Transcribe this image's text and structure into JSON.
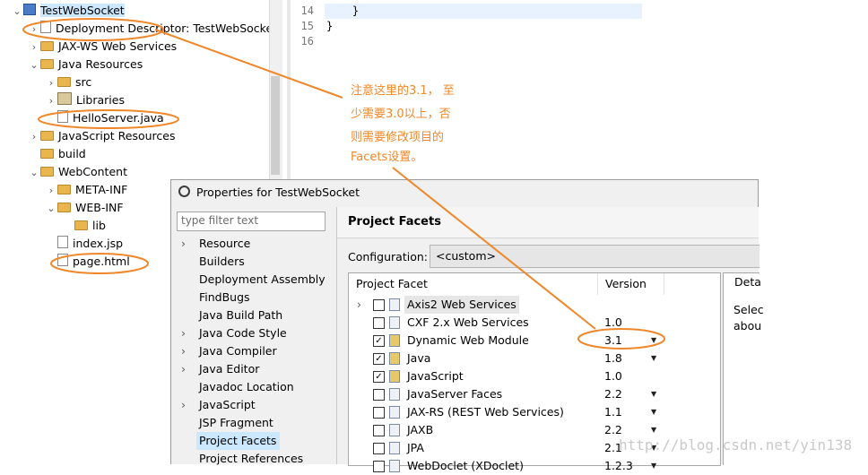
{
  "explorer": {
    "items": [
      {
        "label": "TestWebSocket",
        "arrow": "⌄",
        "icon": "project-icon"
      },
      {
        "label": "Deployment Descriptor: TestWebSocket",
        "arrow": "›",
        "icon": "descriptor-icon"
      },
      {
        "label": "JAX-WS Web Services",
        "arrow": "›",
        "icon": "webservice-icon"
      },
      {
        "label": "Java Resources",
        "arrow": "⌄",
        "icon": "java-resources-icon"
      },
      {
        "label": "src",
        "arrow": "›",
        "icon": "package-folder-icon"
      },
      {
        "label": "Libraries",
        "arrow": "›",
        "icon": "library-icon"
      },
      {
        "label": "HelloServer.java",
        "arrow": "",
        "icon": "java-file-icon"
      },
      {
        "label": "JavaScript Resources",
        "arrow": "›",
        "icon": "js-resources-icon"
      },
      {
        "label": "build",
        "arrow": "",
        "icon": "folder-icon"
      },
      {
        "label": "WebContent",
        "arrow": "⌄",
        "icon": "folder-icon"
      },
      {
        "label": "META-INF",
        "arrow": "›",
        "icon": "folder-icon"
      },
      {
        "label": "WEB-INF",
        "arrow": "⌄",
        "icon": "folder-icon"
      },
      {
        "label": "lib",
        "arrow": "",
        "icon": "folder-icon"
      },
      {
        "label": "index.jsp",
        "arrow": "",
        "icon": "jsp-file-icon"
      },
      {
        "label": "page.html",
        "arrow": "",
        "icon": "html-file-icon"
      }
    ]
  },
  "editor": {
    "lines": [
      {
        "num": "14",
        "code": "    }"
      },
      {
        "num": "15",
        "code": "}"
      },
      {
        "num": "16",
        "code": ""
      }
    ]
  },
  "annotation": {
    "lines": [
      "注意这里的3.1， 至",
      "少需要3.0以上，否",
      "则需要修改项目的",
      "Facets设置。"
    ]
  },
  "dialog": {
    "title": "Properties for TestWebSocket",
    "filter_placeholder": "type filter text",
    "nav": [
      {
        "label": "Resource",
        "arrow": "›"
      },
      {
        "label": "Builders",
        "arrow": ""
      },
      {
        "label": "Deployment Assembly",
        "arrow": ""
      },
      {
        "label": "FindBugs",
        "arrow": ""
      },
      {
        "label": "Java Build Path",
        "arrow": ""
      },
      {
        "label": "Java Code Style",
        "arrow": "›"
      },
      {
        "label": "Java Compiler",
        "arrow": "›"
      },
      {
        "label": "Java Editor",
        "arrow": "›"
      },
      {
        "label": "Javadoc Location",
        "arrow": ""
      },
      {
        "label": "JavaScript",
        "arrow": "›"
      },
      {
        "label": "JSP Fragment",
        "arrow": ""
      },
      {
        "label": "Project Facets",
        "arrow": "",
        "selected": true
      },
      {
        "label": "Project References",
        "arrow": ""
      }
    ],
    "page_title": "Project Facets",
    "configuration_label": "Configuration:",
    "configuration_value": "<custom>",
    "table": {
      "col_facet": "Project Facet",
      "col_version": "Version",
      "rows": [
        {
          "name": "Axis2 Web Services",
          "version": "",
          "checked": false,
          "expander": "›",
          "dropdown": false,
          "highlight": true
        },
        {
          "name": "CXF 2.x Web Services",
          "version": "1.0",
          "checked": false,
          "dropdown": false
        },
        {
          "name": "Dynamic Web Module",
          "version": "3.1",
          "checked": true,
          "dropdown": true
        },
        {
          "name": "Java",
          "version": "1.8",
          "checked": true,
          "dropdown": true
        },
        {
          "name": "JavaScript",
          "version": "1.0",
          "checked": true,
          "dropdown": false
        },
        {
          "name": "JavaServer Faces",
          "version": "2.2",
          "checked": false,
          "dropdown": true
        },
        {
          "name": "JAX-RS (REST Web Services)",
          "version": "1.1",
          "checked": false,
          "dropdown": true
        },
        {
          "name": "JAXB",
          "version": "2.2",
          "checked": false,
          "dropdown": true
        },
        {
          "name": "JPA",
          "version": "2.1",
          "checked": false,
          "dropdown": true
        },
        {
          "name": "WebDoclet (XDoclet)",
          "version": "1.2.3",
          "checked": false,
          "dropdown": true
        }
      ]
    },
    "details_tab": "Deta",
    "details_text_1": "Selec",
    "details_text_2": "abou"
  },
  "watermark": "http://blog.csdn.net/yin138",
  "colors": {
    "annotation": "#f0872a",
    "selection": "#cce8ff",
    "highlight_line": "#e8f2fe"
  }
}
